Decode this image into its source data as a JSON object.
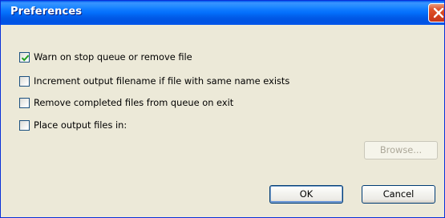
{
  "window": {
    "title": "Preferences"
  },
  "options": [
    {
      "label": "Warn on stop queue or remove file",
      "checked": true
    },
    {
      "label": "Increment output filename if file with same name exists",
      "checked": false
    },
    {
      "label": "Remove completed files from queue on exit",
      "checked": false
    },
    {
      "label": "Place output files in:",
      "checked": false
    }
  ],
  "buttons": {
    "browse": "Browse...",
    "ok": "OK",
    "cancel": "Cancel"
  }
}
